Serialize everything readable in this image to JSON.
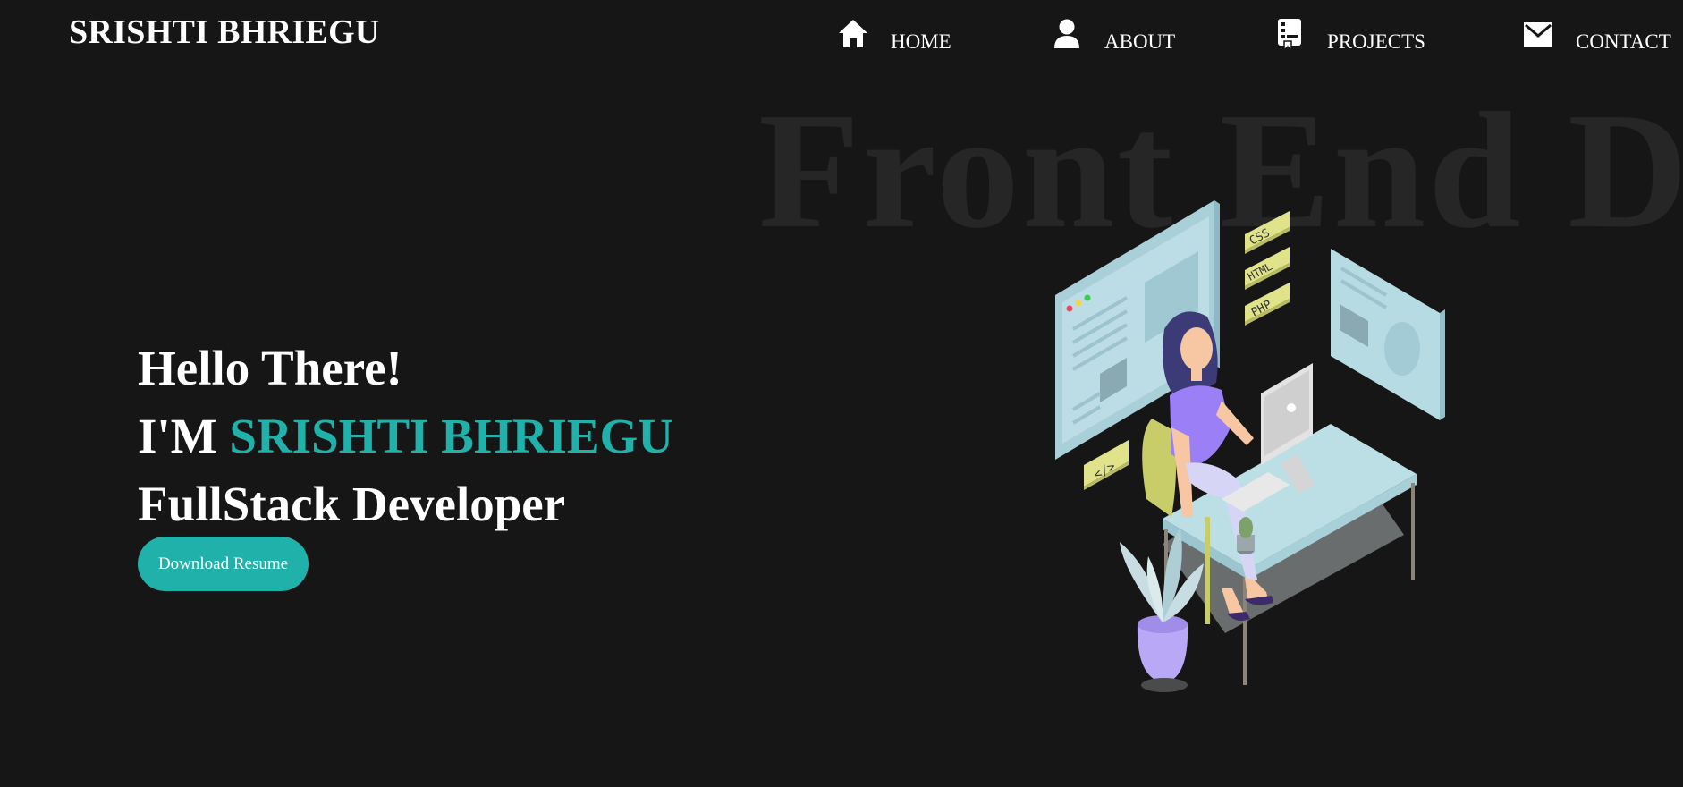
{
  "brand": {
    "name": "SRISHTI BHRIEGU"
  },
  "nav": {
    "items": [
      {
        "label": "HOME",
        "icon": "home-icon"
      },
      {
        "label": "ABOUT",
        "icon": "user-icon"
      },
      {
        "label": "PROJECTS",
        "icon": "projects-icon"
      },
      {
        "label": "CONTACT",
        "icon": "mail-icon"
      }
    ]
  },
  "watermark": {
    "text": "Front End D"
  },
  "hero": {
    "greeting": "Hello There!",
    "intro_prefix": "I'M ",
    "name": "SRISHTI BHRIEGU",
    "role": "FullStack Developer",
    "button_label": "Download Resume"
  },
  "illustration": {
    "tags": [
      "CSS",
      "HTML",
      "PHP"
    ],
    "code_tag": "</>"
  },
  "colors": {
    "background": "#161616",
    "accent": "#20b2aa",
    "text": "#ffffff",
    "watermark": "#262626"
  }
}
